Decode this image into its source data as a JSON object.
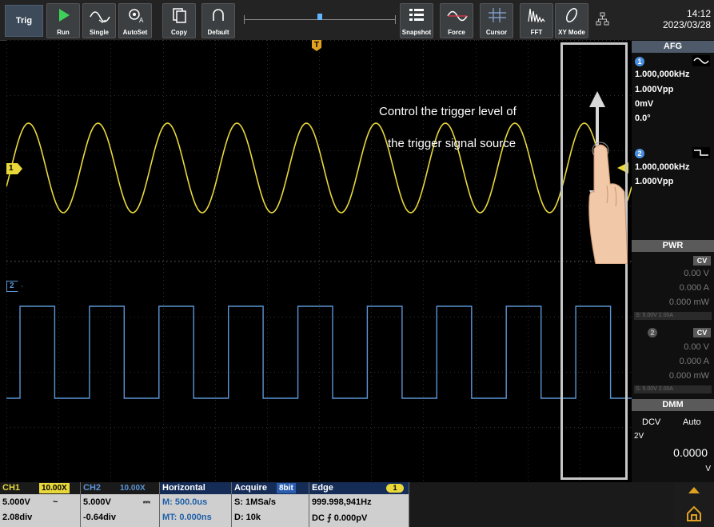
{
  "toolbar": {
    "trig_label": "Trig",
    "buttons": [
      {
        "label": "Run"
      },
      {
        "label": "Single"
      },
      {
        "label": "AutoSet"
      },
      {
        "label": "Copy"
      },
      {
        "label": "Default"
      },
      {
        "label": "Snapshot"
      },
      {
        "label": "Force"
      },
      {
        "label": "Cursor"
      },
      {
        "label": "FFT"
      },
      {
        "label": "XY Mode"
      }
    ],
    "time": "14:12",
    "date": "2023/03/28"
  },
  "scope": {
    "trigger_marker": "T",
    "ch1_marker": "1",
    "ch2_marker": "2"
  },
  "overlay": {
    "line1": "Control the trigger level of",
    "line2": "the trigger signal source"
  },
  "panel": {
    "afg": {
      "title": "AFG",
      "ch1": {
        "num": "1",
        "freq": "1.000,000kHz",
        "amp": "1.000Vpp",
        "offset": "0mV",
        "phase": "0.0°"
      },
      "ch2": {
        "num": "2",
        "freq": "1.000,000kHz",
        "amp": "1.000Vpp"
      }
    },
    "pwr": {
      "title": "PWR",
      "ch1": {
        "mode": "CV",
        "v": "0.00 V",
        "a": "0.000 A",
        "w": "0.000 mW",
        "set": "S: 5.00V 2.00A"
      },
      "ch2": {
        "num": "2",
        "mode": "CV",
        "v": "0.00 V",
        "a": "0.000 A",
        "w": "0.000 mW",
        "set": "S: 5.00V 2.00A"
      }
    },
    "dmm": {
      "title": "DMM",
      "mode": "DCV",
      "range_mode": "Auto",
      "range": "2V",
      "value": "0.0000",
      "unit": "V"
    }
  },
  "bottom": {
    "ch1": {
      "label": "CH1",
      "probe": "10.00X",
      "scale": "5.000V",
      "coupling": "~",
      "position": "2.08div"
    },
    "ch2": {
      "label": "CH2",
      "probe": "10.00X",
      "scale": "5.000V",
      "coupling": "⎓",
      "position": "-0.64div"
    },
    "horizontal": {
      "label": "Horizontal",
      "main": "M: 500.0us",
      "delay": "MT: 0.000ns"
    },
    "acquire": {
      "label": "Acquire",
      "bits": "8bit",
      "rate": "S: 1MSa/s",
      "depth": "D: 10k"
    },
    "trigger": {
      "label": "Edge",
      "source": "1",
      "freq": "999.998,941Hz",
      "level": "DC ⨍ 0.000pV"
    }
  },
  "colors": {
    "ch1": "#e8d83a",
    "ch2": "#5b95d6",
    "accent": "#152c57"
  }
}
